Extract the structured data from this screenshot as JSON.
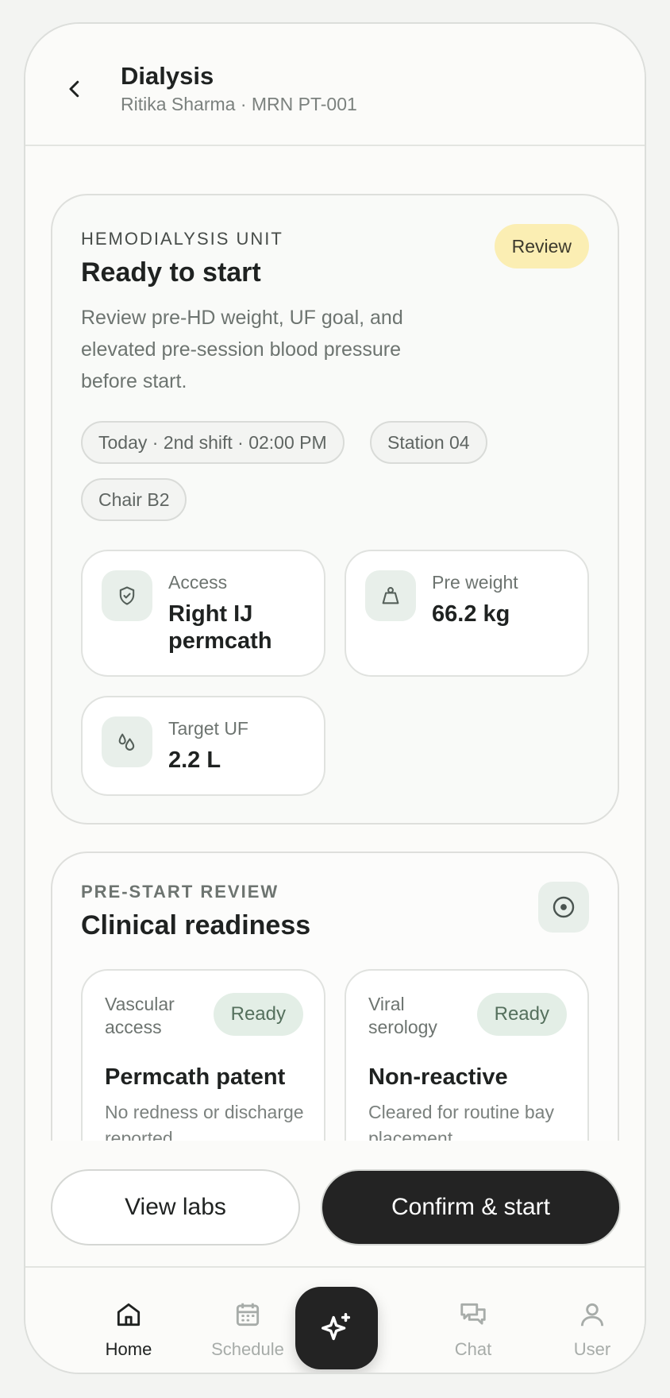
{
  "header": {
    "title": "Dialysis",
    "subtitle": "Ritika Sharma · MRN PT-001"
  },
  "session": {
    "eyebrow": "HEMODIALYSIS UNIT",
    "title": "Ready to start",
    "description": "Review pre-HD weight, UF goal, and elevated pre-session blood pressure before start.",
    "badge": "Review",
    "chips": [
      "Today · 2nd shift · 02:00 PM",
      "Station 04",
      "Chair B2"
    ],
    "stats": [
      {
        "label": "Access",
        "value": "Right IJ permcath",
        "icon": "shield-icon"
      },
      {
        "label": "Pre weight",
        "value": "66.2 kg",
        "icon": "weight-icon"
      },
      {
        "label": "Target UF",
        "value": "2.2 L",
        "icon": "droplets-icon"
      }
    ]
  },
  "review": {
    "eyebrow": "PRE-START REVIEW",
    "title": "Clinical readiness",
    "checks": [
      {
        "label": "Vascular access",
        "status": "Ready",
        "title": "Permcath patent",
        "desc": "No redness or discharge reported"
      },
      {
        "label": "Viral serology",
        "status": "Ready",
        "title": "Non-reactive",
        "desc": "Cleared for routine bay placement"
      }
    ]
  },
  "actions": {
    "secondary": "View labs",
    "primary": "Confirm & start"
  },
  "nav": {
    "items": [
      {
        "label": "Home",
        "icon": "home-icon"
      },
      {
        "label": "Schedule",
        "icon": "calendar-icon"
      },
      {
        "label": "Chat",
        "icon": "chat-icon"
      },
      {
        "label": "User",
        "icon": "user-icon"
      }
    ],
    "fab_icon": "sparkles-icon"
  },
  "colors": {
    "accent_dark": "#232323",
    "badge_review": "#fbeeb3",
    "ready": "#e3eee6",
    "icon_bg": "#e8efea"
  }
}
